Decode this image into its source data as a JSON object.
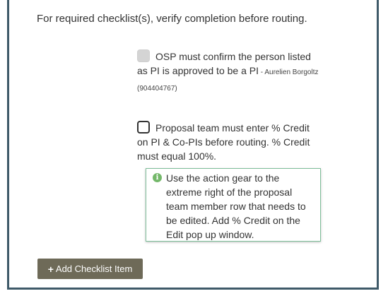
{
  "instruction": "For required checklist(s), verify completion before routing.",
  "checklist": [
    {
      "text": "OSP must confirm the person listed as PI is approved to be a PI",
      "detail": " - Aurelien Borgoltz (904404767)",
      "state": "disabled"
    },
    {
      "text": "Proposal team must enter % Credit on PI & Co-PIs before routing. % Credit must equal 100%.",
      "state": "unchecked"
    }
  ],
  "tooltip": {
    "icon": "info-icon",
    "text": "Use the action gear to the extreme right of the proposal team member row that needs to be edited. Add % Credit on the Edit pop up window."
  },
  "add_button": {
    "icon": "plus-icon",
    "label": "Add Checklist Item"
  },
  "colors": {
    "border": "#3f5a69",
    "button_bg": "#6e6a58",
    "tooltip_border": "#7fbf9a",
    "info_icon": "#74b86a"
  }
}
